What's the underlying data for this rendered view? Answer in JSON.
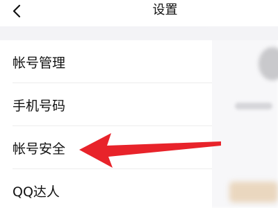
{
  "header": {
    "title": "设置",
    "back_icon": "chevron-left-icon"
  },
  "settings": {
    "items": [
      {
        "label": "帐号管理"
      },
      {
        "label": "手机号码"
      },
      {
        "label": "帐号安全"
      },
      {
        "label": "QQ达人"
      }
    ]
  },
  "annotation": {
    "arrow_color": "#e8232a",
    "points_to": "帐号安全"
  }
}
